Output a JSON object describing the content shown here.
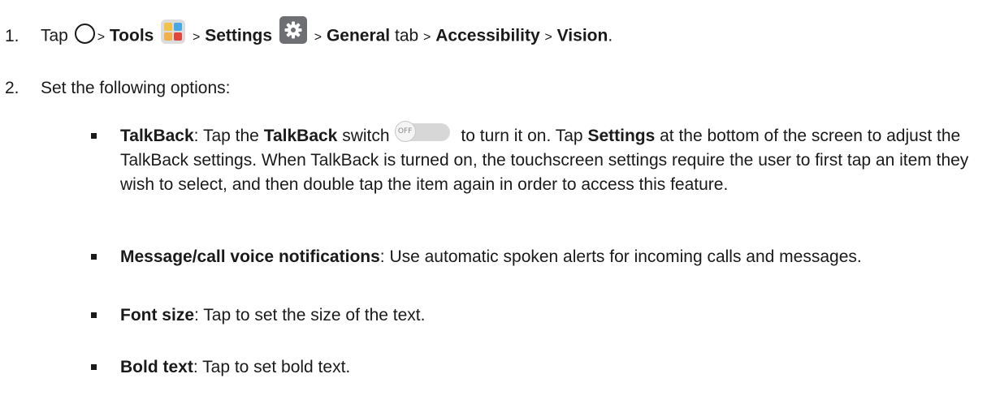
{
  "step1": {
    "number": "1.",
    "tap": "Tap",
    "sep": ">",
    "tools": "Tools",
    "settings": "Settings",
    "general": "General",
    "tab": "tab",
    "accessibility": "Accessibility",
    "vision": "Vision",
    "period": "."
  },
  "step2": {
    "number": "2.",
    "text": "Set the following options:"
  },
  "toggle": {
    "label": "OFF"
  },
  "bullets": {
    "talkback": {
      "title": "TalkBack",
      "a": ": Tap the ",
      "switch_name": "TalkBack",
      "b": " switch",
      "c": " to turn it on. Tap ",
      "settings": "Settings",
      "d": " at the bottom of the screen to adjust the TalkBack settings. When TalkBack is turned on, the touchscreen settings require the user to first tap an item they wish to select, and then double tap the item again in order to access this feature."
    },
    "voice": {
      "title": "Message/call voice notifications",
      "desc": ": Use automatic spoken alerts for incoming calls and messages."
    },
    "font": {
      "title": "Font size",
      "desc": ": Tap to set the size of the text."
    },
    "bold": {
      "title": "Bold text",
      "desc": ": Tap to set bold text."
    }
  },
  "icons": {
    "home": "home-circle-icon",
    "tools": "tools-folder-icon",
    "settings": "settings-gear-icon",
    "bullet": "square-bullet"
  }
}
